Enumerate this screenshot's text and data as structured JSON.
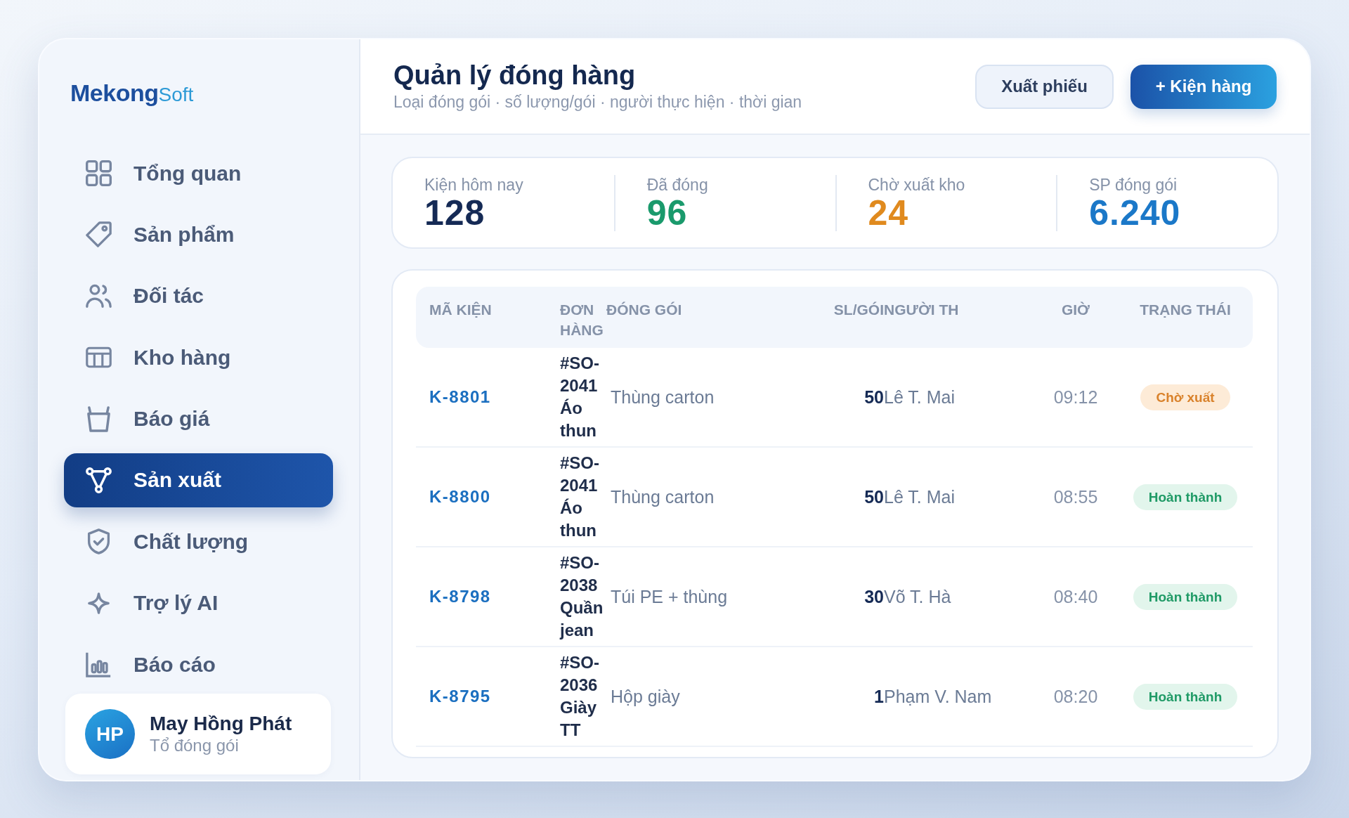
{
  "sidebar": {
    "logo": {
      "primary": "Mekong",
      "secondary": "Soft"
    },
    "items": [
      {
        "label": "Tổng quan",
        "selected": false
      },
      {
        "label": "Sản phẩm",
        "selected": false
      },
      {
        "label": "Đối tác",
        "selected": false
      },
      {
        "label": "Kho hàng",
        "selected": false
      },
      {
        "label": "Báo giá",
        "selected": false
      },
      {
        "label": "Sản xuất",
        "selected": true
      },
      {
        "label": "Chất lượng",
        "selected": false
      },
      {
        "label": "Trợ lý AI",
        "selected": false
      },
      {
        "label": "Báo cáo",
        "selected": false
      }
    ],
    "user": {
      "initials": "HP",
      "name": "May Hồng Phát",
      "role": "Tổ đóng gói"
    }
  },
  "header": {
    "title": "Quản lý đóng hàng",
    "subtitle": "Loại đóng gói · số lượng/gói · người thực hiện · thời gian",
    "buttons": [
      {
        "label": "Xuất phiếu",
        "kind": "secondary"
      },
      {
        "label": "+ Kiện hàng",
        "kind": "primary"
      }
    ]
  },
  "stats": [
    {
      "label": "Kiện hôm nay",
      "value": "128",
      "color": "#152a55"
    },
    {
      "label": "Đã đóng",
      "value": "96",
      "color": "#1a9a6c"
    },
    {
      "label": "Chờ xuất kho",
      "value": "24",
      "color": "#e08a1e"
    },
    {
      "label": "SP đóng gói",
      "value": "6.240",
      "color": "#1b78c8"
    }
  ],
  "table": {
    "columns": [
      "MÃ KIỆN",
      "ĐƠN HÀNG",
      "ĐÓNG GÓI",
      "SL/GÓI",
      "NGƯỜI TH",
      "GIỜ",
      "TRẠNG THÁI"
    ],
    "rows": [
      {
        "id": "K-8801",
        "order": "#SO-2041 Áo thun",
        "packaging": "Thùng carton",
        "qty": "50",
        "worker": "Lê T. Mai",
        "time": "09:12",
        "status": {
          "label": "Chờ xuất",
          "kind": "pending"
        }
      },
      {
        "id": "K-8800",
        "order": "#SO-2041 Áo thun",
        "packaging": "Thùng carton",
        "qty": "50",
        "worker": "Lê T. Mai",
        "time": "08:55",
        "status": {
          "label": "Hoàn thành",
          "kind": "done"
        }
      },
      {
        "id": "K-8798",
        "order": "#SO-2038 Quần jean",
        "packaging": "Túi PE + thùng",
        "qty": "30",
        "worker": "Võ T. Hà",
        "time": "08:40",
        "status": {
          "label": "Hoàn thành",
          "kind": "done"
        }
      },
      {
        "id": "K-8795",
        "order": "#SO-2036 Giày TT",
        "packaging": "Hộp giày",
        "qty": "1",
        "worker": "Phạm V. Nam",
        "time": "08:20",
        "status": {
          "label": "Hoàn thành",
          "kind": "done"
        }
      }
    ]
  }
}
